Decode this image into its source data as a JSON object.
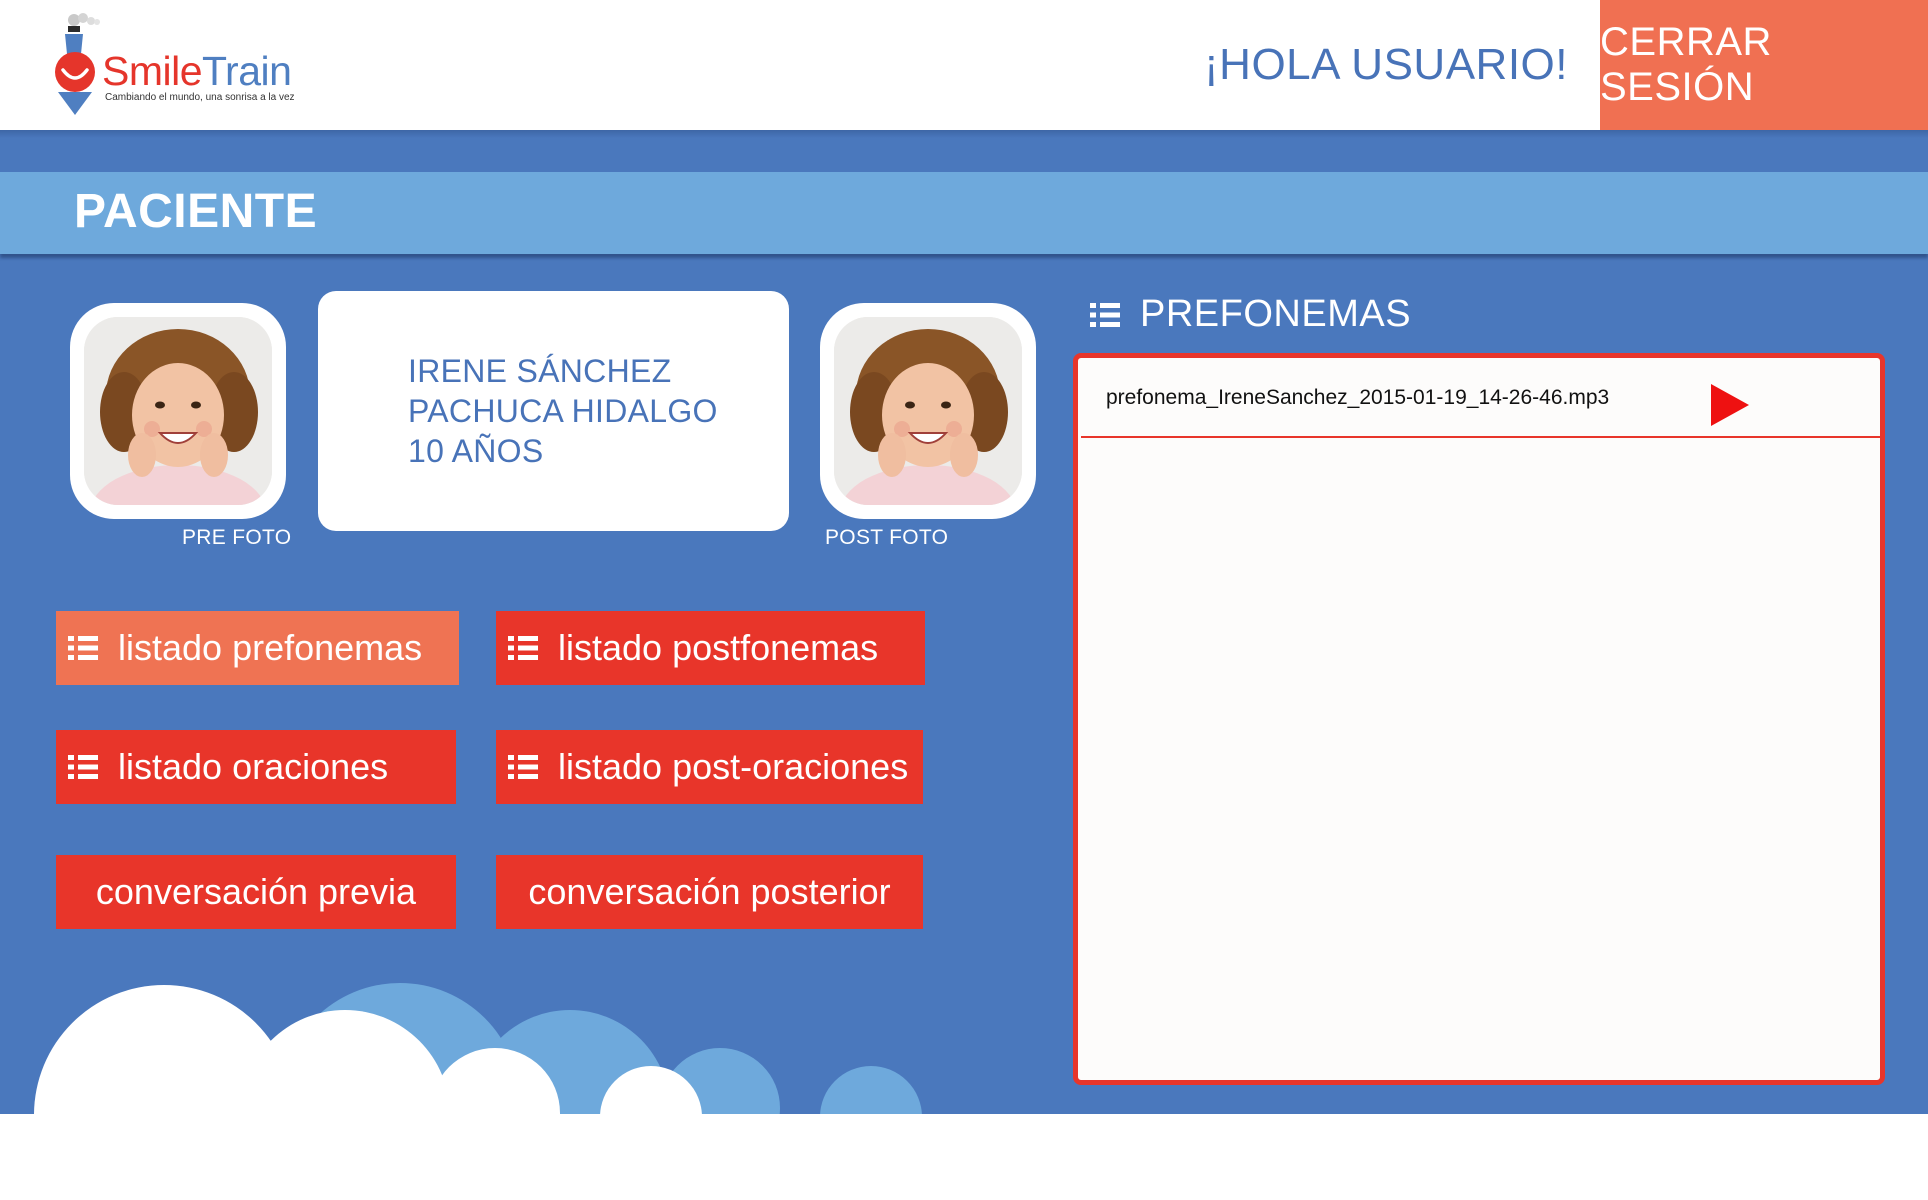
{
  "header": {
    "logo": {
      "name_part1": "Smile",
      "name_part2": "Train",
      "tagline": "Cambiando el mundo, una sonrisa a la vez"
    },
    "greeting": "¡HOLA USUARIO!",
    "logout_label": "CERRAR SESIÓN"
  },
  "section": {
    "title": "PACIENTE"
  },
  "patient": {
    "name": "IRENE SÁNCHEZ",
    "location": "PACHUCA HIDALGO",
    "age": "10 AÑOS",
    "pre_photo_label": "PRE FOTO",
    "post_photo_label": "POST FOTO"
  },
  "actions": {
    "prefonemas": "listado prefonemas",
    "postfonemas": "listado postfonemas",
    "oraciones": "listado oraciones",
    "post_oraciones": "listado post-oraciones",
    "conversacion_previa": "conversación previa",
    "conversacion_posterior": "conversación posterior"
  },
  "panel": {
    "title": "PREFONEMAS",
    "files": [
      {
        "name": "prefonema_IreneSanchez_2015-01-19_14-26-46.mp3"
      }
    ]
  },
  "colors": {
    "header_bg": "#ffffff",
    "brand_blue": "#4873b8",
    "main_bg": "#4a78bd",
    "section_bar": "#6ea9dc",
    "logout_bg": "#f07052",
    "button_red": "#e8352a",
    "button_active": "#ef7353",
    "play_red": "#ee1111"
  },
  "icons": {
    "list": "list-icon",
    "play": "play-icon",
    "logo": "smile-train-logo-icon"
  }
}
